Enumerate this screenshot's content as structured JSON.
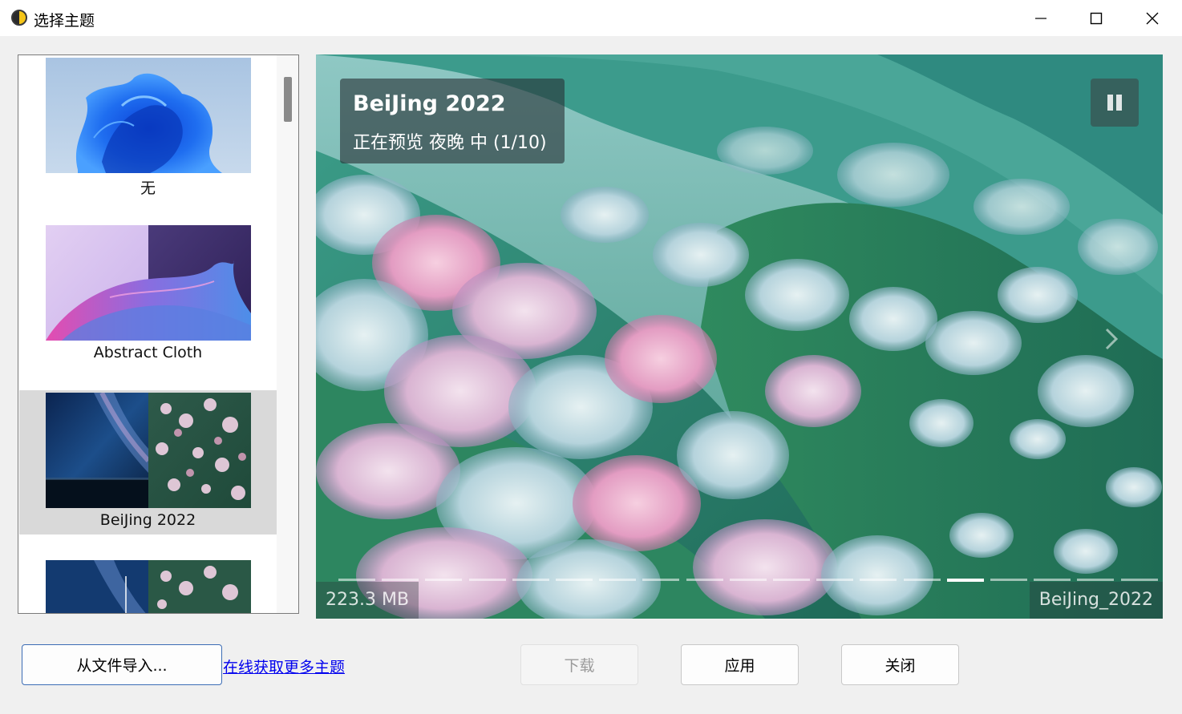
{
  "window": {
    "title": "选择主题"
  },
  "theme_list": {
    "items": [
      {
        "label": "无",
        "selected": false
      },
      {
        "label": "Abstract Cloth",
        "selected": false
      },
      {
        "label": "BeiJing 2022",
        "selected": true
      },
      {
        "label": "",
        "selected": false
      }
    ]
  },
  "preview": {
    "title": "BeiJing 2022",
    "subtitle": "正在预览 夜晚 中 (1/10)",
    "size": "223.3 MB",
    "filename": "BeiJing_2022",
    "segments": 19,
    "active_segment": 14,
    "pause_icon": "pause-icon",
    "next_icon": "chevron-right-icon"
  },
  "buttons": {
    "import": "从文件导入...",
    "online": "在线获取更多主题",
    "download": "下载",
    "apply": "应用",
    "close": "关闭"
  },
  "colors": {
    "link": "#0000ee",
    "selected_item": "#d9d9d9",
    "accent_border": "#3c6db5"
  }
}
